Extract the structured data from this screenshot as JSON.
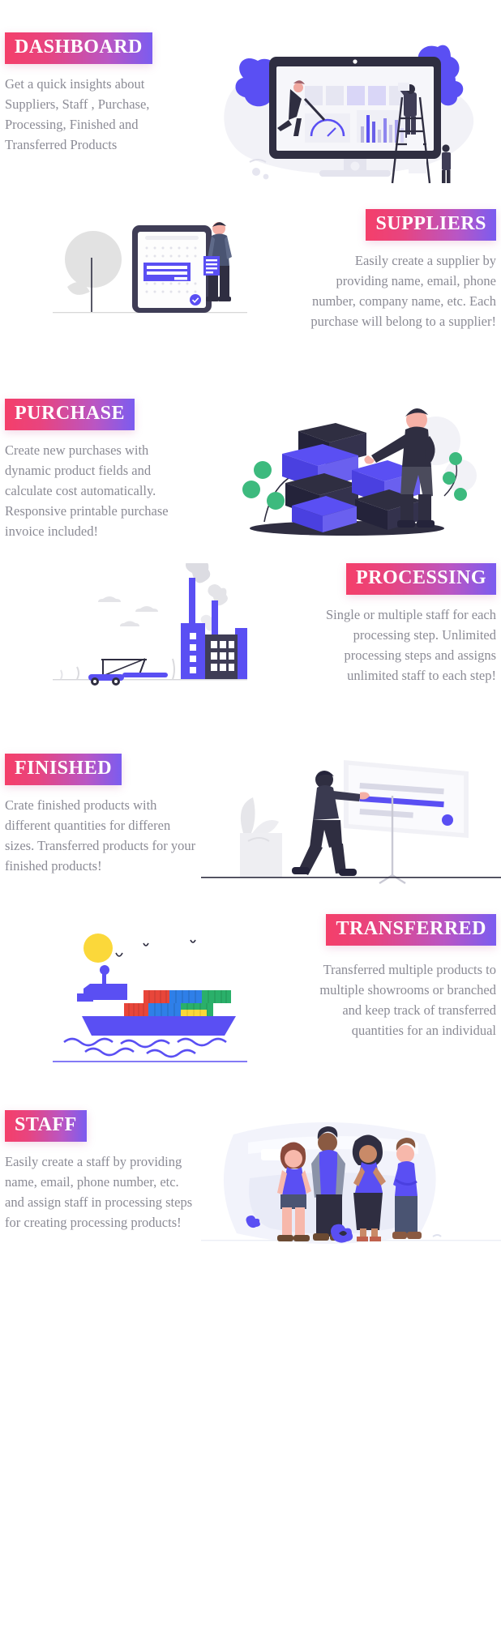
{
  "theme": {
    "badge_gradient_start": "#f43f6a",
    "badge_gradient_end": "#7b5cf0",
    "body_text_color": "#8b8b95",
    "background": "#ffffff",
    "illustration_purple": "#5a4ff3",
    "illustration_dark": "#2f2e41",
    "illustration_light": "#f0f0f6"
  },
  "sections": [
    {
      "id": "dashboard",
      "badge": "DASHBOARD",
      "description": "Get a quick insights about Suppliers, Staff , Purchase, Processing, Finished and Transferred Products",
      "align": "left",
      "illustration": "dashboard-monitor-illustration"
    },
    {
      "id": "suppliers",
      "badge": "SUPPLIERS",
      "description": "Easily create a supplier by providing name, email, phone number, company name, etc. Each purchase will belong to a supplier!",
      "align": "right",
      "illustration": "tablet-form-illustration"
    },
    {
      "id": "purchase",
      "badge": "PURCHASE",
      "description": "Create new purchases with dynamic product fields and calculate cost automatically. Responsive printable purchase invoice included!",
      "align": "left",
      "illustration": "stacked-boxes-illustration"
    },
    {
      "id": "processing",
      "badge": "PROCESSING",
      "description": "Single or multiple staff for each processing step. Unlimited processing steps and assigns unlimited staff to each step!",
      "align": "right",
      "illustration": "factory-illustration"
    },
    {
      "id": "finished",
      "badge": "FINISHED",
      "description": "Crate finished products with different quantities for differen sizes. Transferred products for your finished products!",
      "align": "left",
      "illustration": "presentation-board-illustration"
    },
    {
      "id": "transferred",
      "badge": "TRANSFERRED",
      "description": "Transferred multiple products to multiple showrooms or branched and keep track of transferred quantities for an individual",
      "align": "right",
      "illustration": "cargo-ship-illustration"
    },
    {
      "id": "staff",
      "badge": "STAFF",
      "description": "Easily create a staff by providing name, email, phone number, etc. and assign staff in processing steps for creating processing products!",
      "align": "left",
      "illustration": "staff-group-illustration"
    }
  ]
}
